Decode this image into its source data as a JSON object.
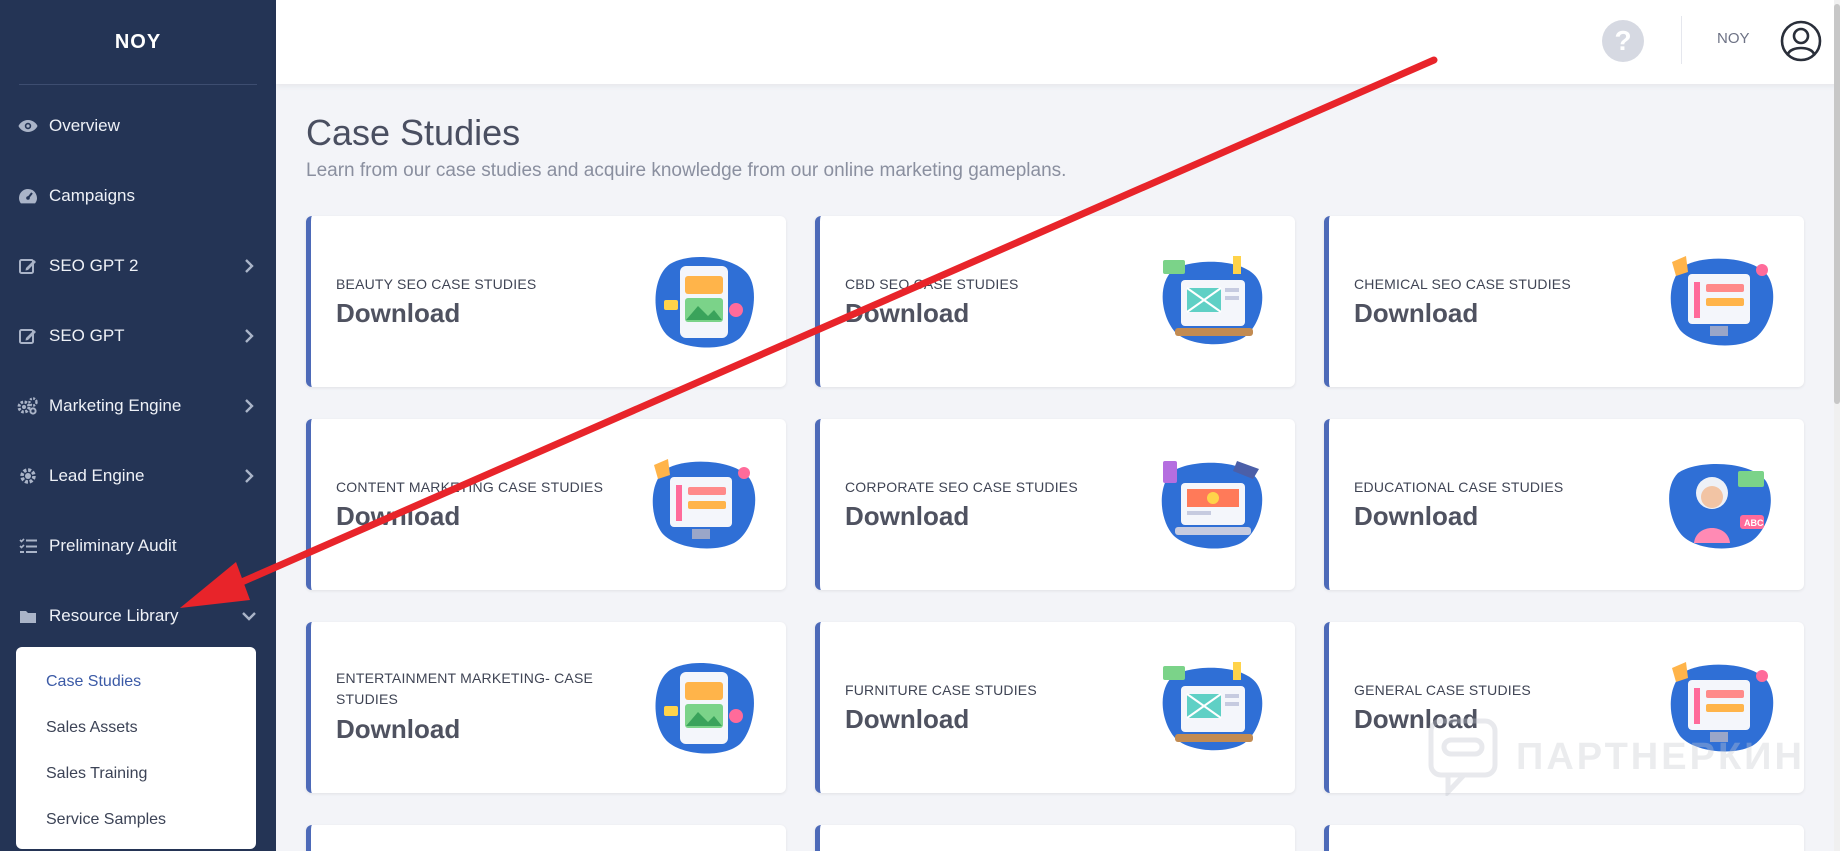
{
  "brand": {
    "name": "NOY"
  },
  "sidebar": {
    "items": [
      {
        "label": "Overview",
        "icon": "eye-icon",
        "has_chevron": false
      },
      {
        "label": "Campaigns",
        "icon": "gauge-icon",
        "has_chevron": false
      },
      {
        "label": "SEO GPT 2",
        "icon": "edit-icon",
        "has_chevron": true
      },
      {
        "label": "SEO GPT",
        "icon": "edit-icon",
        "has_chevron": true
      },
      {
        "label": "Marketing Engine",
        "icon": "cogs-icon",
        "has_chevron": true
      },
      {
        "label": "Lead Engine",
        "icon": "gear-icon",
        "has_chevron": true
      },
      {
        "label": "Preliminary Audit",
        "icon": "list-check-icon",
        "has_chevron": false
      },
      {
        "label": "Resource Library",
        "icon": "folder-icon",
        "has_chevron": true,
        "expanded": true
      }
    ],
    "submenu": [
      {
        "label": "Case Studies",
        "active": true
      },
      {
        "label": "Sales Assets",
        "active": false
      },
      {
        "label": "Sales Training",
        "active": false
      },
      {
        "label": "Service Samples",
        "active": false
      }
    ]
  },
  "topbar": {
    "help_icon": "question-icon",
    "user_name": "NOY",
    "avatar_icon": "user-circle-icon"
  },
  "page": {
    "title": "Case Studies",
    "subtitle": "Learn from our case studies and acquire knowledge from our online marketing gameplans."
  },
  "cards": [
    {
      "category": "BEAUTY SEO CASE STUDIES",
      "action": "Download",
      "illustration": "mobile-gallery-illustration"
    },
    {
      "category": "CBD SEO CASE STUDIES",
      "action": "Download",
      "illustration": "desktop-web-illustration"
    },
    {
      "category": "CHEMICAL SEO CASE STUDIES",
      "action": "Download",
      "illustration": "monitor-chart-illustration"
    },
    {
      "category": "CONTENT MARKETING CASE STUDIES",
      "action": "Download",
      "illustration": "monitor-chart-illustration"
    },
    {
      "category": "CORPORATE SEO CASE STUDIES",
      "action": "Download",
      "illustration": "laptop-books-illustration"
    },
    {
      "category": "EDUCATIONAL CASE STUDIES",
      "action": "Download",
      "illustration": "teacher-illustration"
    },
    {
      "category": "ENTERTAINMENT MARKETING- CASE STUDIES",
      "action": "Download",
      "illustration": "mobile-gallery-illustration"
    },
    {
      "category": "FURNITURE CASE STUDIES",
      "action": "Download",
      "illustration": "desktop-web-illustration"
    },
    {
      "category": "GENERAL CASE STUDIES",
      "action": "Download",
      "illustration": "monitor-chart-illustration"
    }
  ],
  "watermark": {
    "text": "ПАРТНЕРКИН"
  },
  "colors": {
    "sidebar_bg": "#243455",
    "accent": "#4d6ab8",
    "annotation_arrow": "#e8242a"
  }
}
